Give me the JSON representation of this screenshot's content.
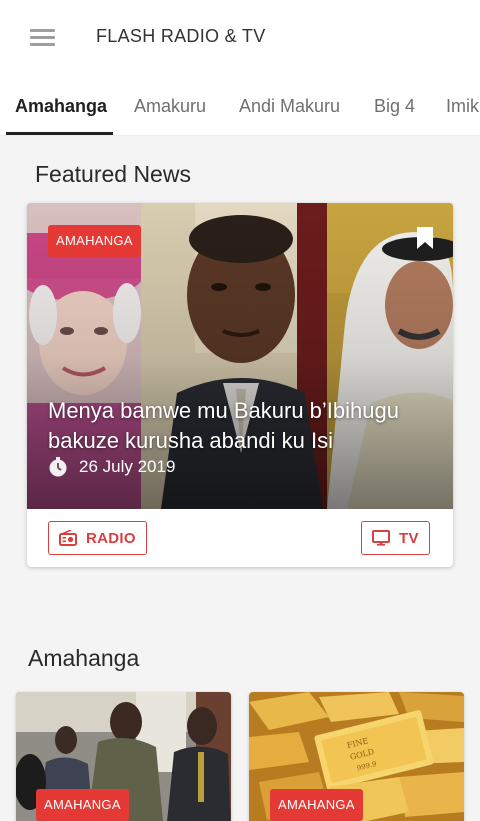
{
  "header": {
    "title": "FLASH RADIO & TV",
    "menu_icon": "hamburger-menu-icon"
  },
  "tabs": [
    {
      "label": "Amahanga",
      "active": true
    },
    {
      "label": "Amakuru",
      "active": false
    },
    {
      "label": "Andi Makuru",
      "active": false
    },
    {
      "label": "Big 4",
      "active": false
    },
    {
      "label": "Imik",
      "active": false
    }
  ],
  "featured": {
    "section_title": "Featured News",
    "category": "AMAHANGA",
    "headline": "Menya bamwe mu Bakuru b’Ibihugu bakuze kurusha abandi ku Isi",
    "date": "26 July 2019",
    "icons": {
      "bookmark": "bookmark-icon",
      "date": "clock-icon"
    },
    "buttons": {
      "radio": "RADIO",
      "tv": "TV"
    },
    "button_icons": {
      "radio": "radio-icon",
      "tv": "tv-monitor-icon"
    }
  },
  "category_section": {
    "title": "Amahanga",
    "items": [
      {
        "category": "AMAHANGA"
      },
      {
        "category": "AMAHANGA",
        "image_text": "FINE GOLD 999.9"
      }
    ]
  },
  "colors": {
    "accent_red": "#e53935",
    "button_red": "#d84040",
    "background": "#f4f4f5"
  }
}
